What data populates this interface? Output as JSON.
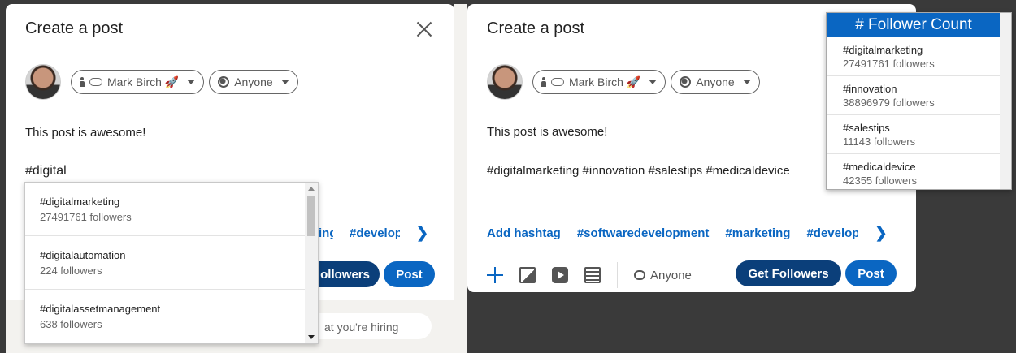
{
  "left_modal": {
    "title": "Create a post",
    "author": "Mark Birch 🚀",
    "visibility": "Anyone",
    "post_text": "This post is awesome!",
    "typed_hashtag": "#digital",
    "suggestions": [
      "#develop"
    ],
    "buttons": {
      "get_followers": "ollowers",
      "post": "Post"
    },
    "dropdown": [
      {
        "tag": "#digitalmarketing",
        "count": "27491761 followers"
      },
      {
        "tag": "#digitalautomation",
        "count": "224 followers"
      },
      {
        "tag": "#digitalassetmanagement",
        "count": "638 followers"
      }
    ],
    "hiring_text": "at you're hiring"
  },
  "right_modal": {
    "title": "Create a post",
    "author": "Mark Birch 🚀",
    "visibility": "Anyone",
    "post_text": "This post is awesome!",
    "hashtags_line": "#digitalmarketing #innovation #salestips #medicaldevice",
    "add_hashtag": "Add hashtag",
    "suggestions": [
      "#softwaredevelopment",
      "#marketing",
      "#develop"
    ],
    "comment_visibility": "Anyone",
    "buttons": {
      "get_followers": "Get Followers",
      "post": "Post"
    }
  },
  "follower_panel": {
    "title": "# Follower Count",
    "items": [
      {
        "tag": "#digitalmarketing",
        "count": "27491761 followers"
      },
      {
        "tag": "#innovation",
        "count": "38896979 followers"
      },
      {
        "tag": "#salestips",
        "count": "11143 followers"
      },
      {
        "tag": "#medicaldevice",
        "count": "42355 followers"
      }
    ]
  },
  "colors": {
    "accent": "#0a66c2",
    "dark_button": "#0b3f7a"
  }
}
